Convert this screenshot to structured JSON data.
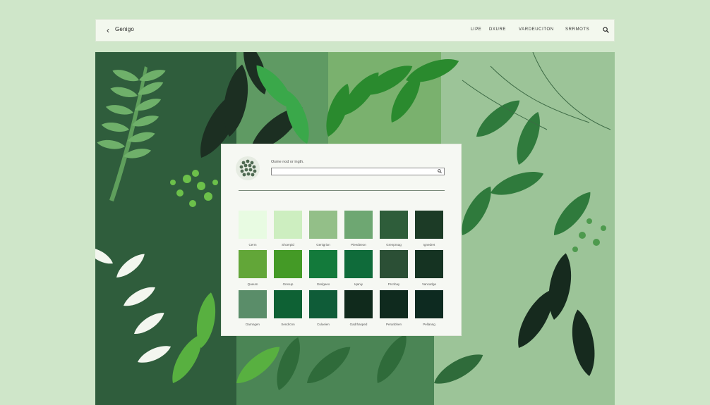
{
  "header": {
    "back_icon": "chevron-left-icon",
    "brand": "Genigo",
    "nav": [
      "LIPE",
      "DXURE",
      "VARDEUCITON",
      "SRRMOTS"
    ],
    "search_icon": "search-icon"
  },
  "panel": {
    "avatar_icon": "leaf-cluster-icon",
    "prompt": "Osme nod or ingth.",
    "input_value": "",
    "input_placeholder": "",
    "swatches": [
      {
        "label": "Cerm",
        "color": "#e8fbe2"
      },
      {
        "label": "Shcerpid",
        "color": "#cdeec0"
      },
      {
        "label": "Genigrion",
        "color": "#93bf88"
      },
      {
        "label": "Pieedtreon",
        "color": "#6ea772"
      },
      {
        "label": "Grenprnag",
        "color": "#2e5d3a"
      },
      {
        "label": "Ignedret",
        "color": "#1c3b26"
      },
      {
        "label": "Queum",
        "color": "#62a638"
      },
      {
        "label": "Gresup",
        "color": "#449a26"
      },
      {
        "label": "Grelgeeo",
        "color": "#137a3b"
      },
      {
        "label": "Iqaniy",
        "color": "#0f6b3a"
      },
      {
        "label": "Prcnhay",
        "color": "#2b4f35"
      },
      {
        "label": "Vancarlge",
        "color": "#153322"
      },
      {
        "label": "Darnngen",
        "color": "#5a8d69"
      },
      {
        "label": "Sendrcnn",
        "color": "#0e6134"
      },
      {
        "label": "Culueien",
        "color": "#0f5c38"
      },
      {
        "label": "Gadrhasped",
        "color": "#102a1c"
      },
      {
        "label": "Peranbhen",
        "color": "#0f2a1e"
      },
      {
        "label": "Pellanng",
        "color": "#0d2a20"
      }
    ]
  }
}
